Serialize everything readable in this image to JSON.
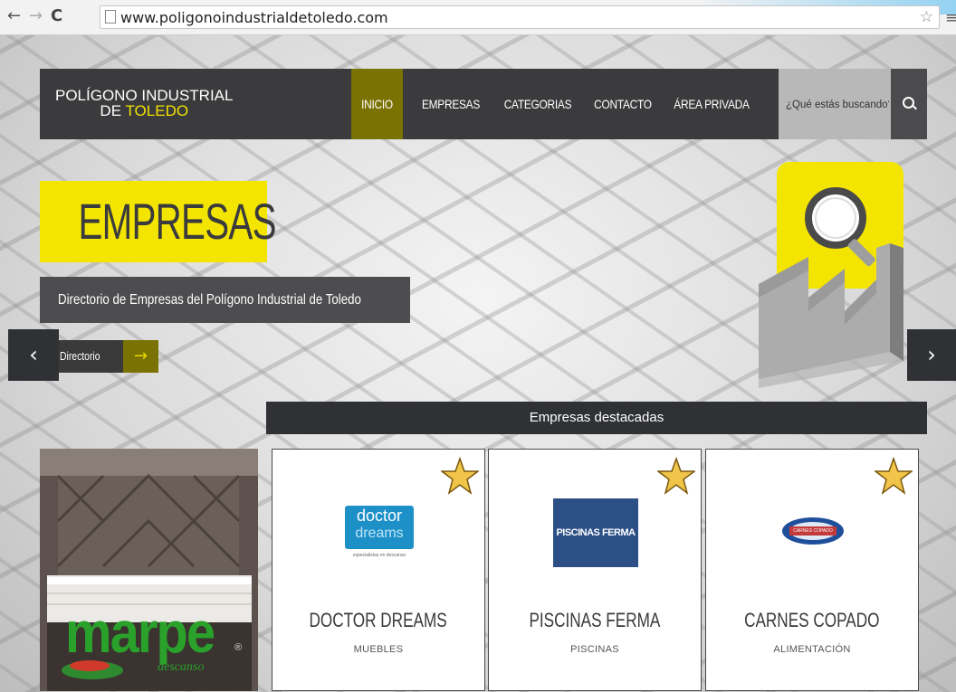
{
  "browser": {
    "url": "www.poligonoindustrialdetoledo.com",
    "back_icon": "←",
    "forward_icon": "→",
    "reload_icon": "C",
    "star_icon": "☆",
    "menu_icon": "≡"
  },
  "header": {
    "logo_line1": "POLÍGONO INDUSTRIAL",
    "logo_line2_prefix": "DE ",
    "logo_line2_highlight": "TOLEDO",
    "nav": [
      "INICIO",
      "EMPRESAS",
      "CATEGORIAS",
      "CONTACTO",
      "ÁREA PRIVADA"
    ],
    "active_nav": "INICIO",
    "search_placeholder": "¿Qué estás buscando?"
  },
  "hero": {
    "title": "EMPRESAS",
    "subtitle": "Directorio de Empresas del Polígono Industrial de Toledo",
    "button_label": "Directorio",
    "button_arrow": "→",
    "prev_arrow": "‹",
    "next_arrow": "›"
  },
  "featured": {
    "heading": "Empresas destacadas",
    "ad": {
      "brand": "marpe",
      "sub": "descanso",
      "mark": "®"
    },
    "cards": [
      {
        "name": "DOCTOR DREAMS",
        "category": "MUEBLES",
        "logo_line1": "doctor",
        "logo_line2": "dreams",
        "logo_tag": "especialistas en descanso"
      },
      {
        "name": "PISCINAS FERMA",
        "category": "PISCINAS",
        "logo_text": "PISCINAS FERMA"
      },
      {
        "name": "CARNES COPADO",
        "category": "ALIMENTACIÓN",
        "logo_text": "CARNES COPADO"
      }
    ]
  },
  "colors": {
    "accent_yellow": "#f4e500",
    "accent_olive": "#7a7202",
    "dark": "#3b3b3d"
  }
}
